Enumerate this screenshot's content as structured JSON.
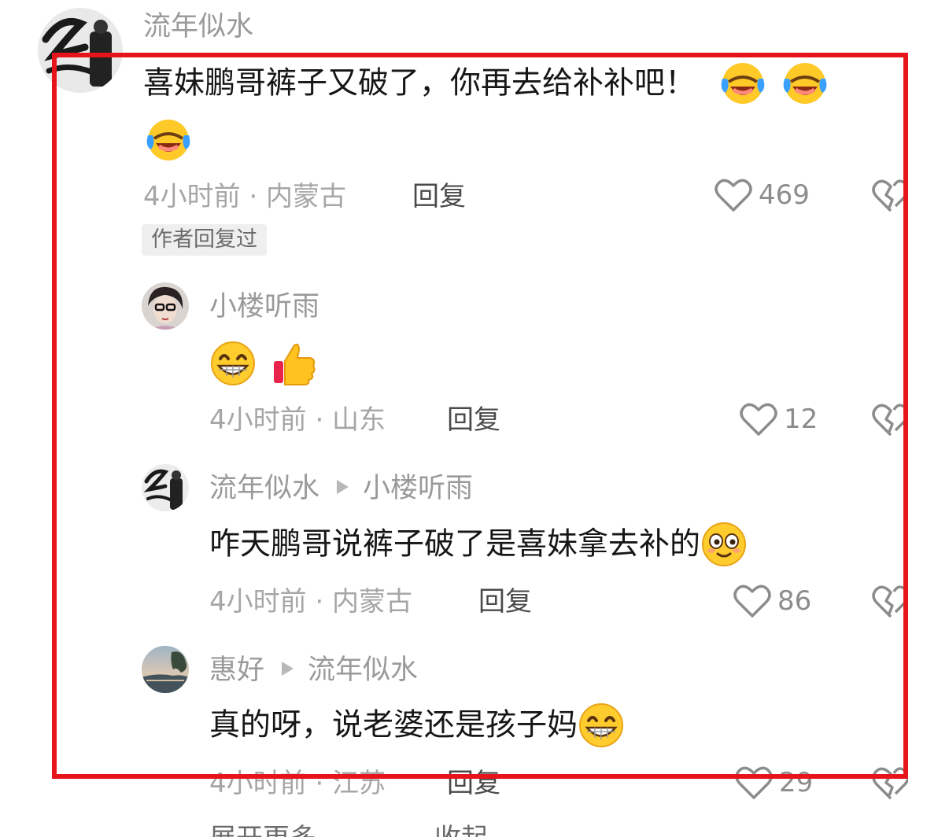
{
  "comment": {
    "user": "流年似水",
    "text": "喜妹鹏哥裤子又破了，你再去给补补吧！",
    "emoji_trailing": [
      "laugh-cry-emoji",
      "laugh-cry-emoji",
      "laugh-cry-emoji"
    ],
    "meta": "4小时前 · 内蒙古",
    "reply_label": "回复",
    "likes": "469",
    "author_badge": "作者回复过"
  },
  "replies": [
    {
      "user": "小楼听雨",
      "reply_to": "",
      "text": "",
      "emoji": [
        "grin-emoji",
        "thumbs-up-emoji"
      ],
      "meta": "4小时前 · 山东",
      "reply_label": "回复",
      "likes": "12"
    },
    {
      "user": "流年似水",
      "reply_to": "小楼听雨",
      "text": "咋天鹏哥说裤子破了是喜妹拿去补的",
      "emoji": [
        "smile-emoji"
      ],
      "meta": "4小时前 · 内蒙古",
      "reply_label": "回复",
      "likes": "86"
    },
    {
      "user": "惠好",
      "reply_to": "流年似水",
      "text": "真的呀，说老婆还是孩子妈",
      "emoji": [
        "grin-emoji"
      ],
      "meta": "4小时前 · 江苏",
      "reply_label": "回复",
      "likes": "29"
    }
  ],
  "footer": {
    "more": "展开更多",
    "collapse": "收起"
  },
  "colors": {
    "highlight_border": "#e8141c",
    "meta_text": "#a6a6a6",
    "username": "#9a9a9a"
  }
}
